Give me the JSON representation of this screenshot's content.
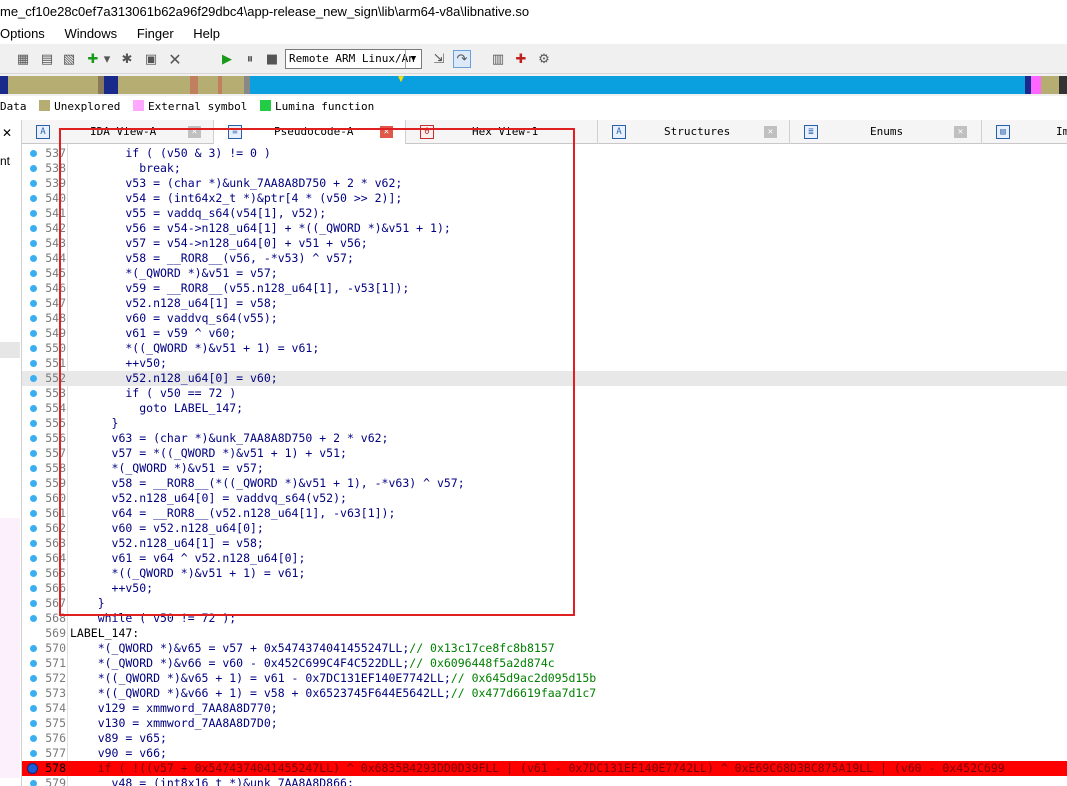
{
  "window": {
    "title": "me_cf10e28c0ef7a313061b62a96f29dbc4\\app-release_new_sign\\lib\\arm64-v8a\\libnative.so"
  },
  "menu": [
    "Options",
    "Windows",
    "Finger",
    "Help"
  ],
  "toolbar": {
    "debugger_select": "Remote ARM Linux/An",
    "icons": [
      "graph-icon",
      "tree-icon",
      "script-icon",
      "plugin-add-icon",
      "dropdown-icon",
      "compile-icon",
      "patch-icon",
      "delete-icon",
      "play-icon",
      "pause-icon",
      "stop-icon",
      "step-into-icon",
      "step-over-icon",
      "notes-icon",
      "bookmark-icon",
      "settings-icon"
    ]
  },
  "legend": [
    {
      "label": "Data",
      "color": "#c0c0c0"
    },
    {
      "label": "Unexplored",
      "color": "#b5ad72"
    },
    {
      "label": "External symbol",
      "color": "#ffa8ff"
    },
    {
      "label": "Lumina function",
      "color": "#22cc44"
    }
  ],
  "left_panel": {
    "close": "✕",
    "label": "nt"
  },
  "tabs": [
    {
      "label": "IDA View-A",
      "icon": "ida-view-icon",
      "active": false
    },
    {
      "label": "Pseudocode-A",
      "icon": "pseudocode-icon",
      "active": true
    },
    {
      "label": "Hex View-1",
      "icon": "hex-view-icon",
      "active": false
    },
    {
      "label": "Structures",
      "icon": "structures-icon",
      "active": false
    },
    {
      "label": "Enums",
      "icon": "enums-icon",
      "active": false
    },
    {
      "label": "Im",
      "icon": "imports-icon",
      "active": false
    }
  ],
  "code_lines": [
    {
      "num": "537",
      "text": "        if ( (v50 & 3) != 0 )"
    },
    {
      "num": "538",
      "text": "          break;"
    },
    {
      "num": "539",
      "text": "        v53 = (char *)&unk_7AA8A8D750 + 2 * v62;"
    },
    {
      "num": "540",
      "text": "        v54 = (int64x2_t *)&ptr[4 * (v50 >> 2)];"
    },
    {
      "num": "541",
      "text": "        v55 = vaddq_s64(v54[1], v52);"
    },
    {
      "num": "542",
      "text": "        v56 = v54->n128_u64[1] + *((_QWORD *)&v51 + 1);"
    },
    {
      "num": "543",
      "text": "        v57 = v54->n128_u64[0] + v51 + v56;"
    },
    {
      "num": "544",
      "text": "        v58 = __ROR8__(v56, -*v53) ^ v57;"
    },
    {
      "num": "545",
      "text": "        *(_QWORD *)&v51 = v57;"
    },
    {
      "num": "546",
      "text": "        v59 = __ROR8__(v55.n128_u64[1], -v53[1]);"
    },
    {
      "num": "547",
      "text": "        v52.n128_u64[1] = v58;"
    },
    {
      "num": "548",
      "text": "        v60 = vaddvq_s64(v55);"
    },
    {
      "num": "549",
      "text": "        v61 = v59 ^ v60;"
    },
    {
      "num": "550",
      "text": "        *((_QWORD *)&v51 + 1) = v61;"
    },
    {
      "num": "551",
      "text": "        ++v50;"
    },
    {
      "num": "552",
      "text": "        v52.n128_u64[0] = v60;"
    },
    {
      "num": "553",
      "text": "        if ( v50 == 72 )"
    },
    {
      "num": "554",
      "text": "          goto LABEL_147;"
    },
    {
      "num": "555",
      "text": "      }"
    },
    {
      "num": "556",
      "text": "      v63 = (char *)&unk_7AA8A8D750 + 2 * v62;"
    },
    {
      "num": "557",
      "text": "      v57 = *((_QWORD *)&v51 + 1) + v51;"
    },
    {
      "num": "558",
      "text": "      *(_QWORD *)&v51 = v57;"
    },
    {
      "num": "559",
      "text": "      v58 = __ROR8__(*((_QWORD *)&v51 + 1), -*v63) ^ v57;"
    },
    {
      "num": "560",
      "text": "      v52.n128_u64[0] = vaddvq_s64(v52);"
    },
    {
      "num": "561",
      "text": "      v64 = __ROR8__(v52.n128_u64[1], -v63[1]);"
    },
    {
      "num": "562",
      "text": "      v60 = v52.n128_u64[0];"
    },
    {
      "num": "563",
      "text": "      v52.n128_u64[1] = v58;"
    },
    {
      "num": "564",
      "text": "      v61 = v64 ^ v52.n128_u64[0];"
    },
    {
      "num": "565",
      "text": "      *((_QWORD *)&v51 + 1) = v61;"
    },
    {
      "num": "566",
      "text": "      ++v50;"
    },
    {
      "num": "567",
      "text": "    }"
    },
    {
      "num": "568",
      "text": "    while ( v50 != 72 );"
    },
    {
      "num": "569",
      "text": "LABEL_147:"
    },
    {
      "num": "570",
      "text": "    *(_QWORD *)&v65 = v57 + 0x5474374041455247LL;// 0x13c17ce8fc8b8157"
    },
    {
      "num": "571",
      "text": "    *(_QWORD *)&v66 = v60 - 0x452C699C4F4C522DLL;// 0x6096448f5a2d874c"
    },
    {
      "num": "572",
      "text": "    *((_QWORD *)&v65 + 1) = v61 - 0x7DC131EF140E7742LL;// 0x645d9ac2d095d15b"
    },
    {
      "num": "573",
      "text": "    *((_QWORD *)&v66 + 1) = v58 + 0x6523745F644E5642LL;// 0x477d6619faa7d1c7"
    },
    {
      "num": "574",
      "text": "    v129 = xmmword_7AA8A8D770;"
    },
    {
      "num": "575",
      "text": "    v130 = xmmword_7AA8A8D7D0;"
    },
    {
      "num": "576",
      "text": "    v89 = v65;"
    },
    {
      "num": "577",
      "text": "    v90 = v66;"
    },
    {
      "num": "578",
      "text": "    if ( !((v57 + 0x5474374041455247LL) ^ 0x6835B4293DD0D39FLL | (v61 - 0x7DC131EF140E7742LL) ^ 0xE69C68D3BC875A19LL | (v60 - 0x452C699"
    },
    {
      "num": "579",
      "text": "      v48 = (int8x16_t *)&unk_7AA8A8D866;"
    }
  ],
  "highlighted_line": "552",
  "breakpoint_line": "578",
  "colors": {
    "selection_box": "#e02020",
    "breakpoint": "#ff0000",
    "code_text": "#000080",
    "comment": "#008000",
    "line_dot": "#39aef0"
  }
}
